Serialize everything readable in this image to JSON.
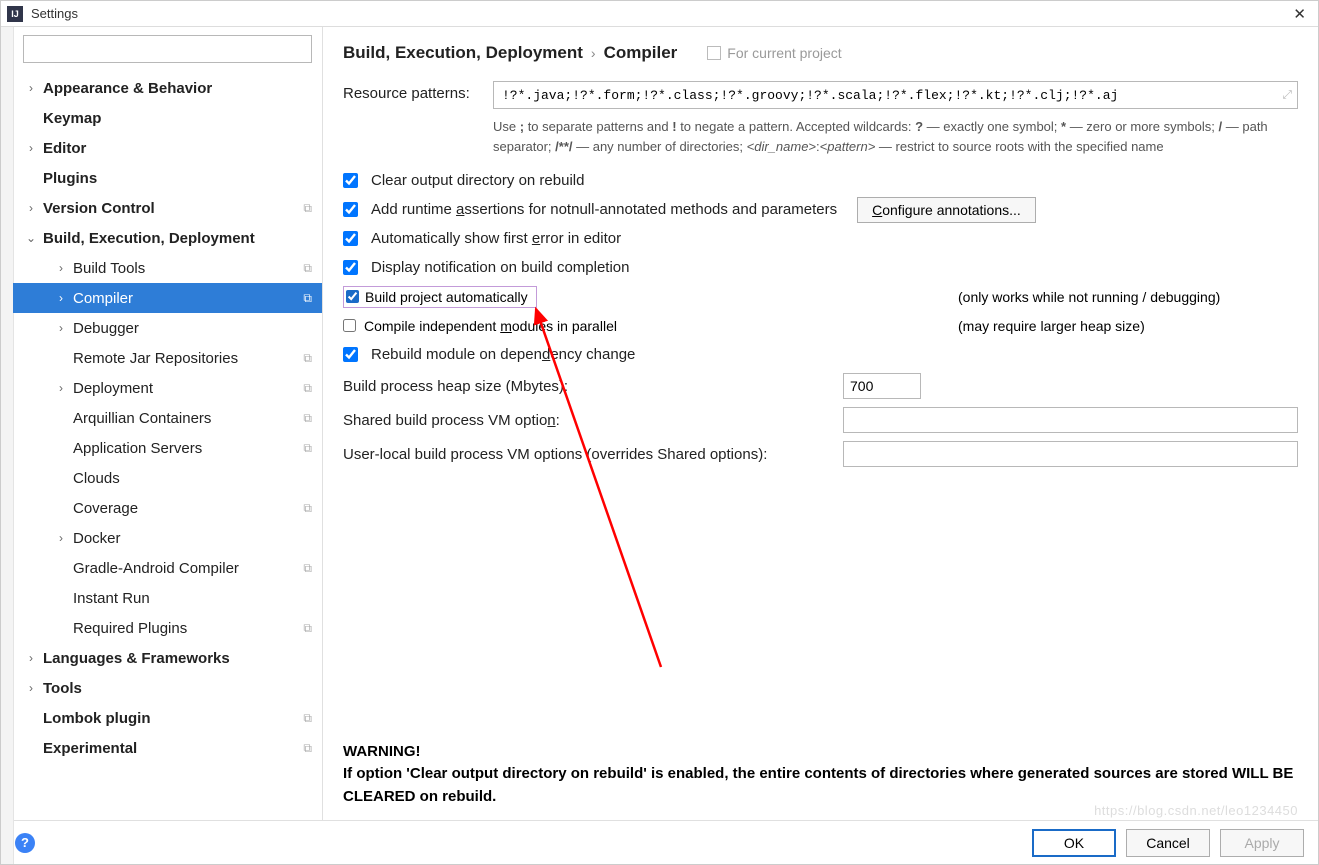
{
  "window": {
    "title": "Settings",
    "app_icon_text": "IJ"
  },
  "search": {
    "placeholder": ""
  },
  "tree": {
    "items": [
      {
        "label": "Appearance & Behavior",
        "level": 0,
        "arrow": "›",
        "bold": true
      },
      {
        "label": "Keymap",
        "level": 0,
        "arrow": "",
        "bold": true
      },
      {
        "label": "Editor",
        "level": 0,
        "arrow": "›",
        "bold": true
      },
      {
        "label": "Plugins",
        "level": 0,
        "arrow": "",
        "bold": true
      },
      {
        "label": "Version Control",
        "level": 0,
        "arrow": "›",
        "bold": true,
        "badge": "⧉"
      },
      {
        "label": "Build, Execution, Deployment",
        "level": 0,
        "arrow": "⌄",
        "bold": true
      },
      {
        "label": "Build Tools",
        "level": 1,
        "arrow": "›",
        "badge": "⧉"
      },
      {
        "label": "Compiler",
        "level": 1,
        "arrow": "›",
        "badge": "⧉",
        "selected": true
      },
      {
        "label": "Debugger",
        "level": 1,
        "arrow": "›"
      },
      {
        "label": "Remote Jar Repositories",
        "level": 1,
        "arrow": "",
        "badge": "⧉"
      },
      {
        "label": "Deployment",
        "level": 1,
        "arrow": "›",
        "badge": "⧉"
      },
      {
        "label": "Arquillian Containers",
        "level": 1,
        "arrow": "",
        "badge": "⧉"
      },
      {
        "label": "Application Servers",
        "level": 1,
        "arrow": "",
        "badge": "⧉"
      },
      {
        "label": "Clouds",
        "level": 1,
        "arrow": ""
      },
      {
        "label": "Coverage",
        "level": 1,
        "arrow": "",
        "badge": "⧉"
      },
      {
        "label": "Docker",
        "level": 1,
        "arrow": "›"
      },
      {
        "label": "Gradle-Android Compiler",
        "level": 1,
        "arrow": "",
        "badge": "⧉"
      },
      {
        "label": "Instant Run",
        "level": 1,
        "arrow": ""
      },
      {
        "label": "Required Plugins",
        "level": 1,
        "arrow": "",
        "badge": "⧉"
      },
      {
        "label": "Languages & Frameworks",
        "level": 0,
        "arrow": "›",
        "bold": true
      },
      {
        "label": "Tools",
        "level": 0,
        "arrow": "›",
        "bold": true
      },
      {
        "label": "Lombok plugin",
        "level": 0,
        "arrow": "",
        "bold": true,
        "badge": "⧉"
      },
      {
        "label": "Experimental",
        "level": 0,
        "arrow": "",
        "bold": true,
        "badge": "⧉"
      }
    ]
  },
  "breadcrumb": {
    "parent": "Build, Execution, Deployment",
    "current": "Compiler",
    "scope": "For current project"
  },
  "resource": {
    "label": "Resource patterns:",
    "value": "!?*.java;!?*.form;!?*.class;!?*.groovy;!?*.scala;!?*.flex;!?*.kt;!?*.clj;!?*.aj",
    "help_pre": "Use ",
    "help_sep": ";",
    "help_mid1": " to separate patterns and ",
    "help_neg": "!",
    "help_mid2": " to negate a pattern. Accepted wildcards: ",
    "wc_q": "?",
    "wc_q_desc": " — exactly one symbol; ",
    "wc_star": "*",
    "wc_star_desc": " — zero or more symbols; ",
    "wc_slash": "/",
    "wc_slash_desc": " — path separator; ",
    "wc_dstar": "/**/",
    "wc_dstar_desc": " — any number of directories; ",
    "wc_dir": "<dir_name>",
    "wc_colon": ":",
    "wc_pat": "<pattern>",
    "wc_suffix": " — restrict to source roots with the specified name"
  },
  "checks": {
    "clear_output": "Clear output directory on rebuild",
    "clear_checked": true,
    "add_runtime_pre": "Add runtime ",
    "add_runtime_u": "a",
    "add_runtime_post": "ssertions for notnull-annotated methods and parameters",
    "add_runtime_checked": true,
    "configure_btn_pre": "",
    "configure_btn_u": "C",
    "configure_btn_post": "onfigure annotations...",
    "auto_error_pre": "Automatically show first ",
    "auto_error_u": "e",
    "auto_error_post": "rror in editor",
    "auto_error_checked": true,
    "display_notification": "Display notification on build completion",
    "display_checked": true,
    "build_auto": "Build project automatically",
    "build_auto_checked": true,
    "build_auto_note": "(only works while not running / debugging)",
    "compile_parallel_pre": "Compile independent ",
    "compile_parallel_u": "m",
    "compile_parallel_post": "odules in parallel",
    "compile_parallel_checked": false,
    "compile_parallel_note": "(may require larger heap size)",
    "rebuild_dep_pre": "Rebuild module on depen",
    "rebuild_dep_u": "d",
    "rebuild_dep_post": "ency change",
    "rebuild_checked": true
  },
  "fields": {
    "heap_label": "Build process heap size (Mbytes):",
    "heap_value": "700",
    "shared_vm_label_pre": "Shared build process VM optio",
    "shared_vm_label_u": "n",
    "shared_vm_label_post": ":",
    "shared_vm_value": "",
    "user_vm_label": "User-local build process VM options (overrides Shared options):",
    "user_vm_value": ""
  },
  "warning": {
    "title": "WARNING!",
    "body": "If option 'Clear output directory on rebuild' is enabled, the entire contents of directories where generated sources are stored WILL BE CLEARED on rebuild."
  },
  "footer": {
    "ok": "OK",
    "cancel": "Cancel",
    "apply": "Apply"
  },
  "watermark": "https://blog.csdn.net/leo1234450"
}
